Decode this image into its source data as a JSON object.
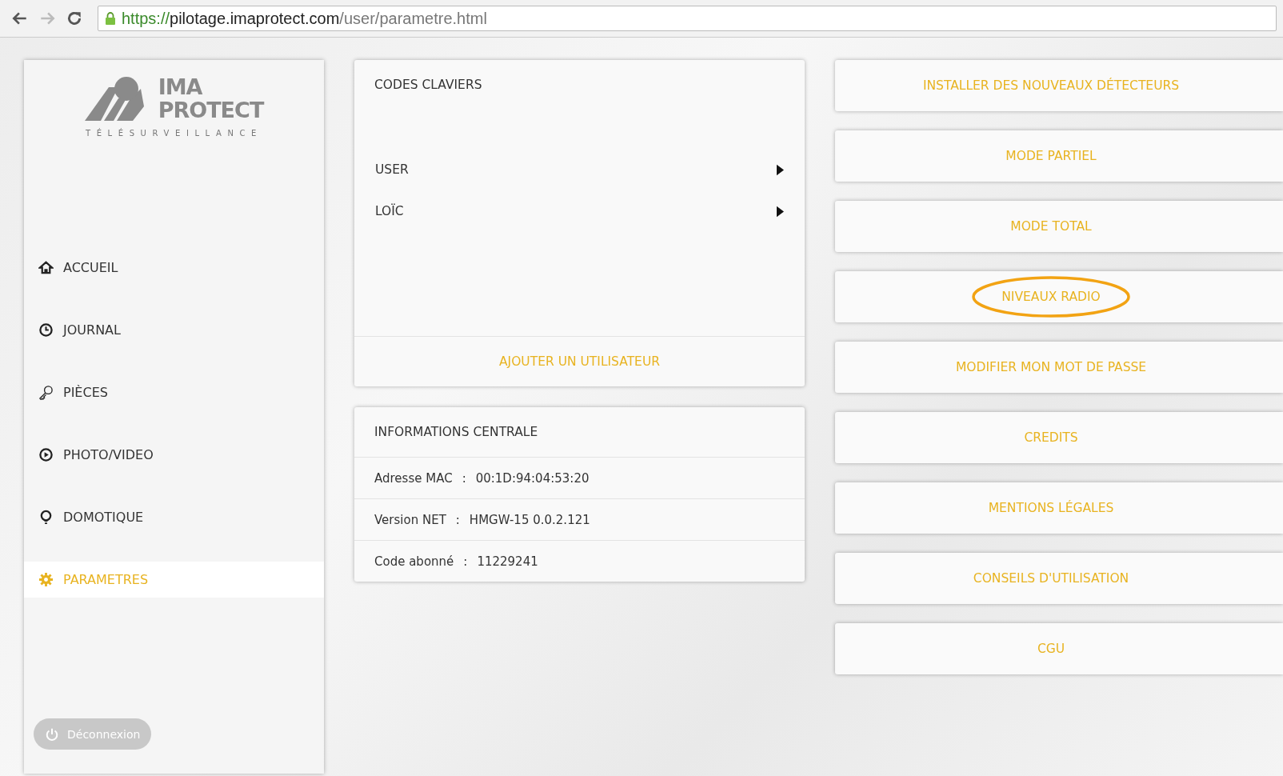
{
  "browser": {
    "url_scheme": "https://",
    "url_host": "pilotage.imaprotect.com",
    "url_path": "/user/parametre.html"
  },
  "logo": {
    "line1": "IMA",
    "line2": "PROTECT",
    "tagline": "TÉLÉSURVEILLANCE"
  },
  "sidebar": {
    "items": [
      {
        "label": "ACCUEIL",
        "kind": "home",
        "selected": false
      },
      {
        "label": "JOURNAL",
        "kind": "clock",
        "selected": false
      },
      {
        "label": "PIÈCES",
        "kind": "key",
        "selected": false
      },
      {
        "label": "PHOTO/VIDEO",
        "kind": "play",
        "selected": false
      },
      {
        "label": "DOMOTIQUE",
        "kind": "bulb",
        "selected": false
      },
      {
        "label": "PARAMETRES",
        "kind": "gear",
        "selected": true
      }
    ],
    "logout": "Déconnexion"
  },
  "codes": {
    "title": "CODES CLAVIERS",
    "users": [
      "USER",
      "LOÏC"
    ],
    "add": "AJOUTER UN UTILISATEUR"
  },
  "info": {
    "title": "INFORMATIONS CENTRALE",
    "rows": [
      {
        "label": "Adresse MAC",
        "separator": ":",
        "value": "00:1D:94:04:53:20"
      },
      {
        "label": "Version NET",
        "separator": ":",
        "value": "HMGW-15 0.0.2.121"
      },
      {
        "label": "Code abonné",
        "separator": ":",
        "value": "11229241"
      }
    ]
  },
  "actions": [
    {
      "label": "INSTALLER DES NOUVEAUX DÉTECTEURS",
      "circled": false
    },
    {
      "label": "MODE PARTIEL",
      "circled": false
    },
    {
      "label": "MODE TOTAL",
      "circled": false
    },
    {
      "label": "NIVEAUX RADIO",
      "circled": true
    },
    {
      "label": "MODIFIER MON MOT DE PASSE",
      "circled": false
    },
    {
      "label": "CREDITS",
      "circled": false
    },
    {
      "label": "MENTIONS LÉGALES",
      "circled": false
    },
    {
      "label": "CONSEILS D'UTILISATION",
      "circled": false
    },
    {
      "label": "CGU",
      "circled": false
    }
  ]
}
